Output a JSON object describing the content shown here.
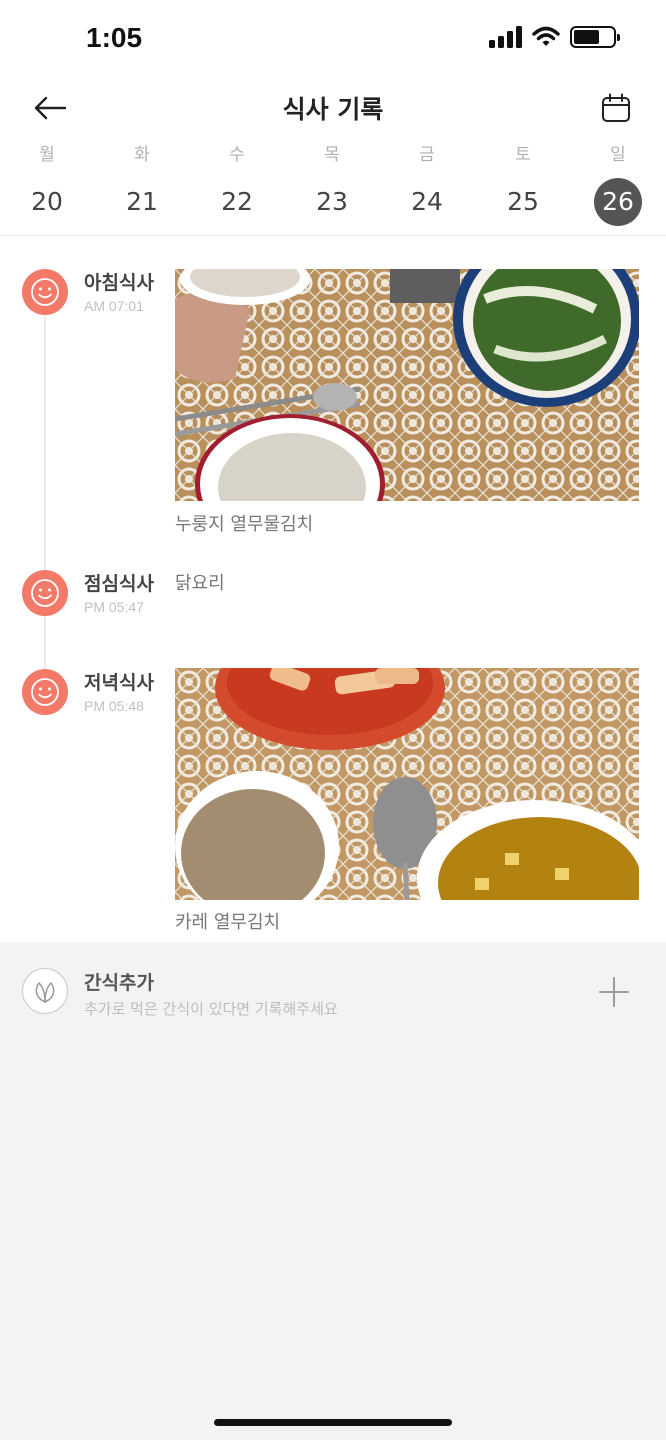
{
  "status_bar": {
    "time": "1:05",
    "battery_level": 0.65
  },
  "header": {
    "title": "식사 기록",
    "back_icon": "arrow-left-icon",
    "calendar_icon": "calendar-icon"
  },
  "week": {
    "days": [
      {
        "dow": "월",
        "date": "20"
      },
      {
        "dow": "화",
        "date": "21"
      },
      {
        "dow": "수",
        "date": "22"
      },
      {
        "dow": "목",
        "date": "23"
      },
      {
        "dow": "금",
        "date": "24"
      },
      {
        "dow": "토",
        "date": "25"
      },
      {
        "dow": "일",
        "date": "26"
      }
    ],
    "selected": "26"
  },
  "meals": [
    {
      "name": "아침식사",
      "time": "AM 07:01",
      "caption": "누룽지 열무물김치",
      "icon": "smiley-icon"
    },
    {
      "name": "점심식사",
      "time": "PM 05:47",
      "caption": "닭요리",
      "icon": "smiley-icon"
    },
    {
      "name": "저녁식사",
      "time": "PM 05:48",
      "caption": "카레 열무김치",
      "icon": "smiley-icon"
    }
  ],
  "snack": {
    "title": "간식추가",
    "subtitle": "추가로 먹은 간식이 있다면 기록해주세요",
    "icon": "leaf-icon",
    "add_icon": "plus-icon"
  },
  "colors": {
    "accent": "#f37a68",
    "selected_day": "#555555",
    "background": "#f3f3f3"
  }
}
